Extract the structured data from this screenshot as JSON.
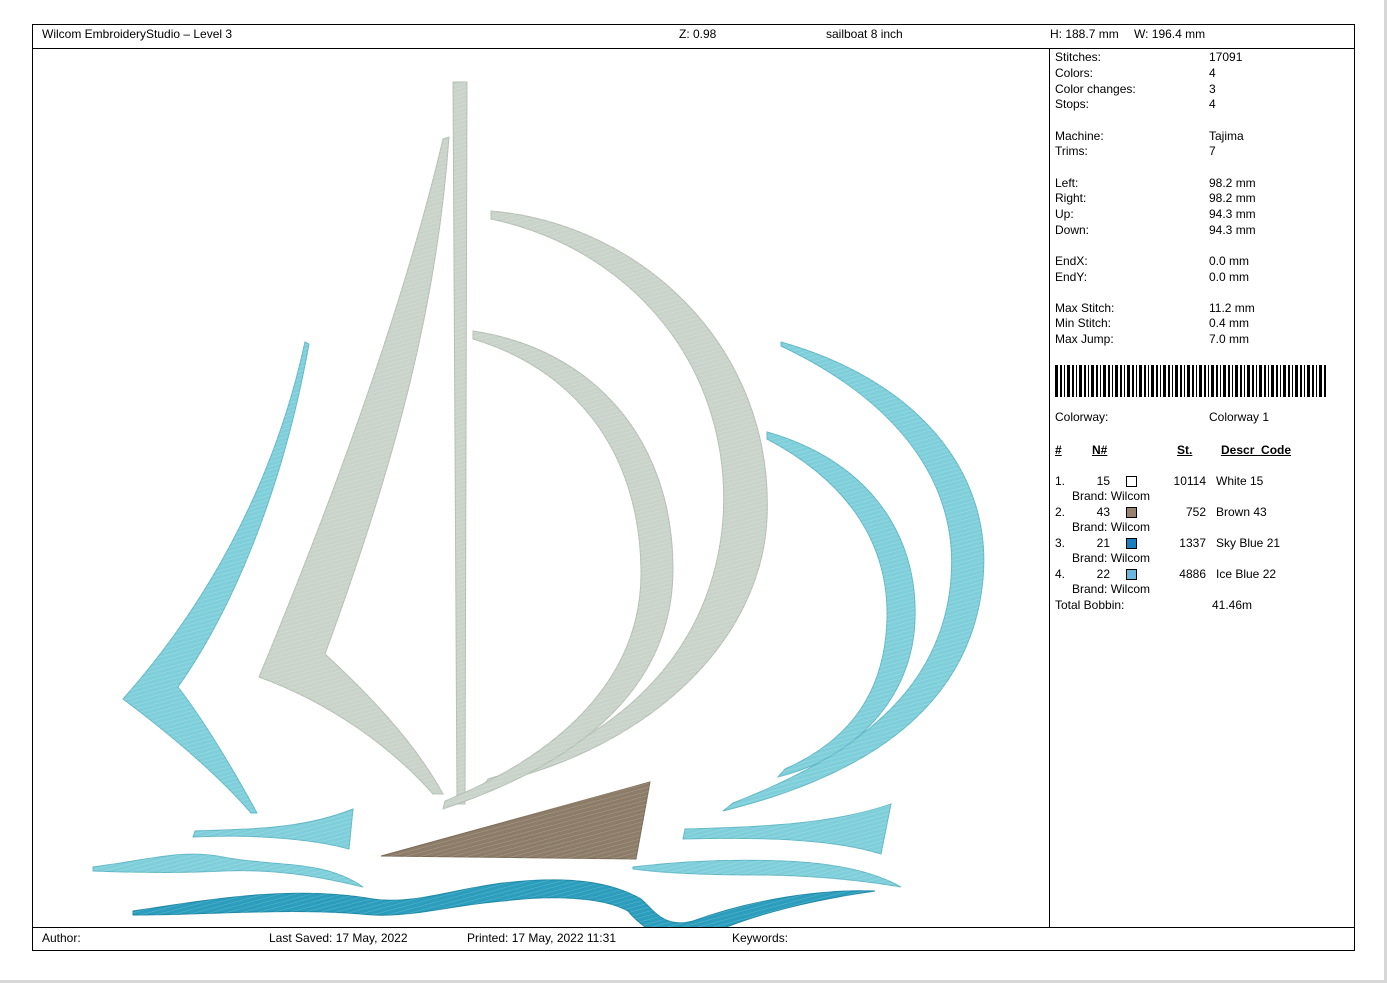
{
  "header": {
    "app_title": "Wilcom EmbroideryStudio – Level 3",
    "zoom": "Z: 0.98",
    "design_name": "sailboat 8 inch",
    "height": "H: 188.7 mm",
    "width": "W: 196.4 mm"
  },
  "stats": {
    "stitches_label": "Stitches:",
    "stitches": "17091",
    "colors_label": "Colors:",
    "colors": "4",
    "color_changes_label": "Color changes:",
    "color_changes": "3",
    "stops_label": "Stops:",
    "stops": "4",
    "machine_label": "Machine:",
    "machine": "Tajima",
    "trims_label": "Trims:",
    "trims": "7",
    "left_label": "Left:",
    "left": "98.2 mm",
    "right_label": "Right:",
    "right": "98.2 mm",
    "up_label": "Up:",
    "up": "94.3 mm",
    "down_label": "Down:",
    "down": "94.3 mm",
    "endx_label": "EndX:",
    "endx": "0.0 mm",
    "endy_label": "EndY:",
    "endy": "0.0 mm",
    "max_stitch_label": "Max Stitch:",
    "max_stitch": "11.2 mm",
    "min_stitch_label": "Min Stitch:",
    "min_stitch": "0.4 mm",
    "max_jump_label": "Max Jump:",
    "max_jump": "7.0 mm",
    "colorway_label": "Colorway:",
    "colorway": "Colorway 1"
  },
  "color_table": {
    "col_index": "#",
    "col_number": "N#",
    "col_stitches": "St.",
    "col_desc": "Descr_Code",
    "rows": [
      {
        "index": "1.",
        "number": "15",
        "color": "#ffffff",
        "stitches": "10114",
        "desc": "White 15",
        "brand": "Brand: Wilcom"
      },
      {
        "index": "2.",
        "number": "43",
        "color": "#96826e",
        "stitches": "752",
        "desc": "Brown 43",
        "brand": "Brand: Wilcom"
      },
      {
        "index": "3.",
        "number": "21",
        "color": "#1a7fc0",
        "stitches": "1337",
        "desc": "Sky Blue 21",
        "brand": "Brand: Wilcom"
      },
      {
        "index": "4.",
        "number": "22",
        "color": "#6ab8e0",
        "stitches": "4886",
        "desc": "Ice Blue 22",
        "brand": "Brand: Wilcom"
      }
    ],
    "total_bobbin_label": "Total Bobbin:",
    "total_bobbin": "41.46m"
  },
  "footer": {
    "author": "Author:",
    "last_saved": "Last Saved: 17 May, 2022",
    "printed": "Printed: 17 May, 2022 11:31",
    "keywords": "Keywords:"
  },
  "colors": {
    "sail_white": "#c9d3c9",
    "brown": "#8c7c68",
    "sky_blue": "#2b9dbd",
    "ice_blue": "#7fcfdb"
  }
}
